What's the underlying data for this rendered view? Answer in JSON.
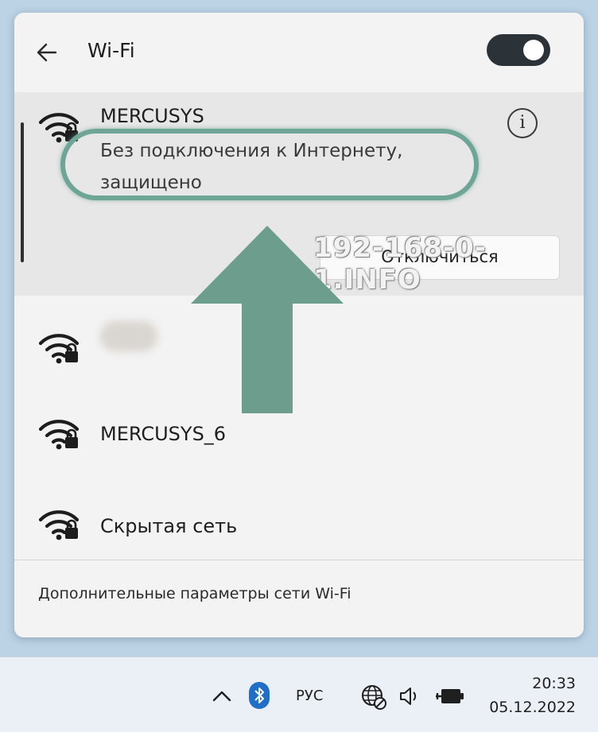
{
  "header": {
    "back_icon": "back-arrow-icon",
    "title": "Wi-Fi",
    "wifi_enabled": true
  },
  "connected_network": {
    "name": "MERCUSYS",
    "status_line1": "Без подключения к Интернету,",
    "status_line2": "защищено",
    "info_icon": "info-icon",
    "info_glyph": "i",
    "disconnect_label": "Отключиться"
  },
  "annotations": {
    "watermark": "192-168-0-1.INFO",
    "highlight_color": "#6fa596",
    "arrow_color": "#6c9d8d"
  },
  "networks": [
    {
      "name": "",
      "blurred": true,
      "icon": "wifi-secured-icon"
    },
    {
      "name": "MERCUSYS_6",
      "icon": "wifi-secured-icon"
    },
    {
      "name": "Скрытая сеть",
      "icon": "wifi-secured-icon"
    }
  ],
  "footer": {
    "link": "Дополнительные параметры сети Wi-Fi"
  },
  "taskbar": {
    "overflow_icon": "chevron-up-icon",
    "bluetooth_icon": "bluetooth-icon",
    "language": "РУС",
    "network_icon": "globe-no-internet-icon",
    "volume_icon": "speaker-icon",
    "battery_icon": "battery-charging-icon",
    "time": "20:33",
    "date": "05.12.2022"
  }
}
